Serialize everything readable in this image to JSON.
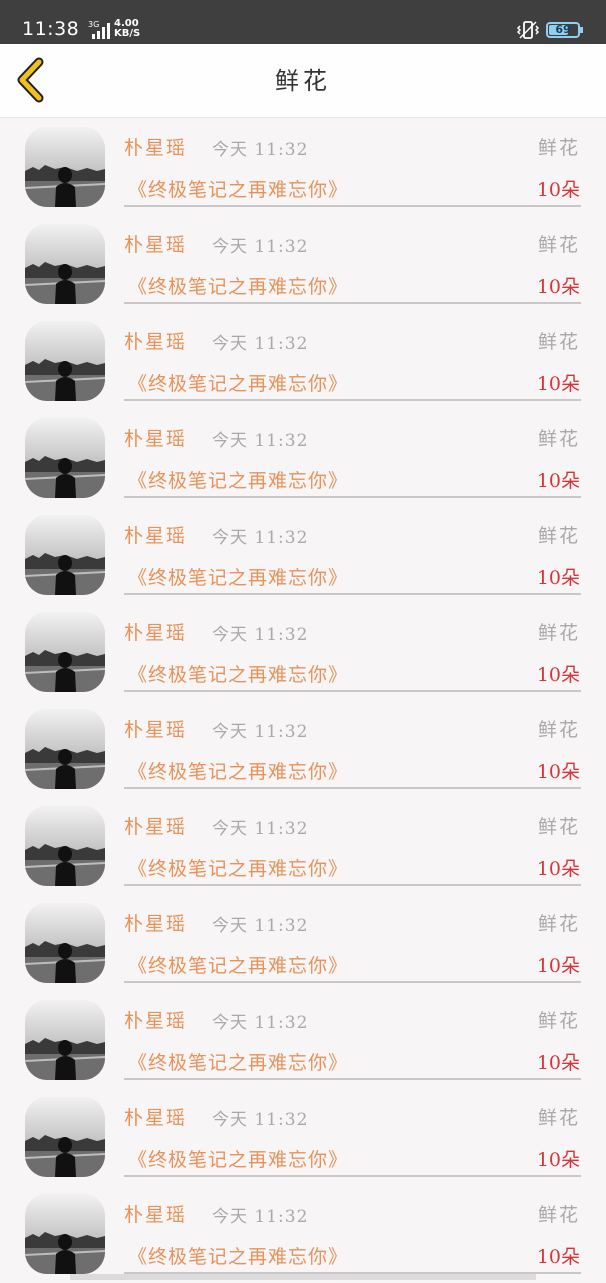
{
  "status_bar": {
    "time": "11:38",
    "network_type": "3G",
    "speed_value": "4.00",
    "speed_unit": "KB/S",
    "battery": "69",
    "battery_level": 0.69
  },
  "header": {
    "title": "鲜花"
  },
  "list": {
    "items": [
      {
        "name": "朴星瑶",
        "time": "今天 11:32",
        "gift": "鲜花",
        "book": "《终极笔记之再难忘你》",
        "count": "10朵"
      },
      {
        "name": "朴星瑶",
        "time": "今天 11:32",
        "gift": "鲜花",
        "book": "《终极笔记之再难忘你》",
        "count": "10朵"
      },
      {
        "name": "朴星瑶",
        "time": "今天 11:32",
        "gift": "鲜花",
        "book": "《终极笔记之再难忘你》",
        "count": "10朵"
      },
      {
        "name": "朴星瑶",
        "time": "今天 11:32",
        "gift": "鲜花",
        "book": "《终极笔记之再难忘你》",
        "count": "10朵"
      },
      {
        "name": "朴星瑶",
        "time": "今天 11:32",
        "gift": "鲜花",
        "book": "《终极笔记之再难忘你》",
        "count": "10朵"
      },
      {
        "name": "朴星瑶",
        "time": "今天 11:32",
        "gift": "鲜花",
        "book": "《终极笔记之再难忘你》",
        "count": "10朵"
      },
      {
        "name": "朴星瑶",
        "time": "今天 11:32",
        "gift": "鲜花",
        "book": "《终极笔记之再难忘你》",
        "count": "10朵"
      },
      {
        "name": "朴星瑶",
        "time": "今天 11:32",
        "gift": "鲜花",
        "book": "《终极笔记之再难忘你》",
        "count": "10朵"
      },
      {
        "name": "朴星瑶",
        "time": "今天 11:32",
        "gift": "鲜花",
        "book": "《终极笔记之再难忘你》",
        "count": "10朵"
      },
      {
        "name": "朴星瑶",
        "time": "今天 11:32",
        "gift": "鲜花",
        "book": "《终极笔记之再难忘你》",
        "count": "10朵"
      },
      {
        "name": "朴星瑶",
        "time": "今天 11:32",
        "gift": "鲜花",
        "book": "《终极笔记之再难忘你》",
        "count": "10朵"
      },
      {
        "name": "朴星瑶",
        "time": "今天 11:32",
        "gift": "鲜花",
        "book": "《终极笔记之再难忘你》",
        "count": "10朵"
      }
    ]
  },
  "icons": {
    "back": "chevron-left-icon",
    "avatar": "user-avatar-photo",
    "signal": "signal-icon",
    "vibrate": "vibrate-icon",
    "battery": "battery-icon"
  },
  "colors": {
    "accent_orange": "#e8925a",
    "count_red": "#d8343a",
    "back_chevron": "#f0c020",
    "muted_gray": "#a9a9a9",
    "status_bar_bg": "#3f3f3f"
  }
}
